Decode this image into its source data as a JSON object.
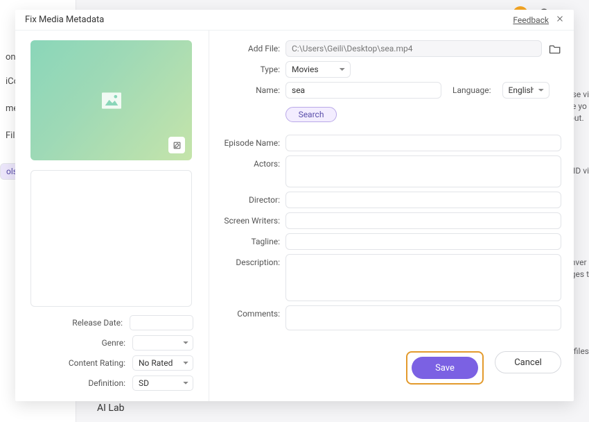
{
  "background": {
    "sidebar_items": [
      "onde",
      "iCon",
      "me",
      "Fil",
      "ols"
    ],
    "avatar_letter": "?",
    "right_snippets": [
      "use vi\nke yo\n out.",
      "ID vi",
      "nver\nges t",
      "r files"
    ],
    "bottom_label": "AI Lab"
  },
  "modal": {
    "title": "Fix Media Metadata",
    "feedback": "Feedback",
    "left": {
      "release_date_label": "Release Date:",
      "release_date_value": "",
      "genre_label": "Genre:",
      "genre_value": "",
      "content_rating_label": "Content Rating:",
      "content_rating_value": "No Rated",
      "definition_label": "Definition:",
      "definition_value": "SD"
    },
    "form": {
      "add_file_label": "Add File:",
      "add_file_value": "C:\\Users\\Geili\\Desktop\\sea.mp4",
      "type_label": "Type:",
      "type_value": "Movies",
      "name_label": "Name:",
      "name_value": "sea",
      "language_label": "Language:",
      "language_value": "English",
      "search_label": "Search",
      "episode_name_label": "Episode Name:",
      "episode_name_value": "",
      "actors_label": "Actors:",
      "actors_value": "",
      "director_label": "Director:",
      "director_value": "",
      "screen_writers_label": "Screen Writers:",
      "screen_writers_value": "",
      "tagline_label": "Tagline:",
      "tagline_value": "",
      "description_label": "Description:",
      "description_value": "",
      "comments_label": "Comments:",
      "comments_value": ""
    },
    "footer": {
      "save_label": "Save",
      "cancel_label": "Cancel"
    }
  }
}
